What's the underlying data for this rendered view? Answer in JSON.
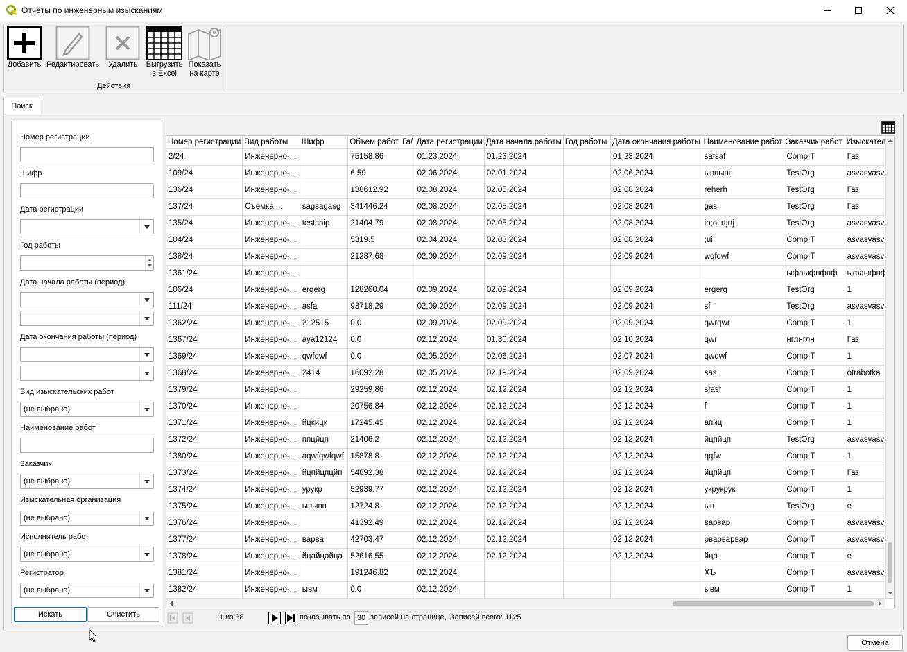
{
  "window": {
    "title": "Отчёты по инженерным изысканиям",
    "app_icon": "qgis-icon"
  },
  "toolbar": {
    "add_label": "Добавить",
    "edit_label": "Редактировать",
    "delete_label": "Удалить",
    "export_label_1": "Выгрузить",
    "export_label_2": "в Excel",
    "map_label_1": "Показать",
    "map_label_2": "на карте",
    "group_label": "Действия"
  },
  "tab": {
    "label": "Поиск"
  },
  "search": {
    "reg_number_label": "Номер регистрации",
    "cipher_label": "Шифр",
    "reg_date_label": "Дата регистрации",
    "work_year_label": "Год работы",
    "start_period_label": "Дата начала работы (период)",
    "end_period_label": "Дата окончания работы (период)",
    "survey_type_label": "Вид изыскательских работ",
    "survey_type_value": "(не выбрано)",
    "work_name_label": "Наименование работ",
    "customer_label": "Заказчик",
    "customer_value": "(не выбрано)",
    "survey_org_label": "Изыскательная организация",
    "survey_org_value": "(не выбрано)",
    "executor_label": "Исполнитель работ",
    "executor_value": "(не выбрано)",
    "registrar_label": "Регистратор",
    "registrar_value": "(не выбрано)",
    "search_button": "Искать",
    "clear_button": "Очистить"
  },
  "table": {
    "columns": [
      "Номер регистрации",
      "Вид работы",
      "Шифр",
      "Объем работ, Га/",
      "Дата регистрации",
      "Дата начала работы",
      "Год работы",
      "Дата окончания работы",
      "Наименование работ",
      "Заказчик работ",
      "Изыскатель"
    ],
    "rows": [
      [
        "2/24",
        "Инженерно-...",
        "",
        "75158.86",
        "01.23.2024",
        "01.23.2024",
        "",
        "01.23.2024",
        "safsaf",
        "CompIT",
        "Газ"
      ],
      [
        "109/24",
        "Инженерно-...",
        "",
        "6.59",
        "02.06.2024",
        "02.01.2024",
        "",
        "02.06.2024",
        "ывпывп",
        "TestOrg",
        "asvasvasv"
      ],
      [
        "136/24",
        "Инженерно-...",
        "",
        "138612.92",
        "02.08.2024",
        "02.05.2024",
        "",
        "02.08.2024",
        "reherh",
        "TestOrg",
        "Газ"
      ],
      [
        "137/24",
        "Съемка ...",
        "sagsagasg",
        "341446.24",
        "02.08.2024",
        "02.05.2024",
        "",
        "02.08.2024",
        "gas",
        "TestOrg",
        "Газ"
      ],
      [
        "135/24",
        "Инженерно-...",
        "testship",
        "21404.79",
        "02.08.2024",
        "02.05.2024",
        "",
        "02.08.2024",
        "io;oi;rtjrtj",
        "TestOrg",
        "asvasvasv"
      ],
      [
        "104/24",
        "Инженерно-...",
        "",
        "5319.5",
        "02.04.2024",
        "02.03.2024",
        "",
        "02.08.2024",
        ";ui",
        "CompIT",
        "asvasvasv"
      ],
      [
        "138/24",
        "Инженерно-...",
        "",
        "21287.68",
        "02.09.2024",
        "02.09.2024",
        "",
        "02.09.2024",
        "wqfqwf",
        "CompIT",
        "asvasvasv"
      ],
      [
        "1361/24",
        "Инженерно-...",
        "",
        "",
        "",
        "",
        "",
        "",
        "",
        "ыфаыфпфпф",
        "ыфаыфпф"
      ],
      [
        "106/24",
        "Инженерно-...",
        "ergerg",
        "128260.04",
        "02.09.2024",
        "02.09.2024",
        "",
        "02.09.2024",
        "ergerg",
        "TestOrg",
        "1"
      ],
      [
        "111/24",
        "Инженерно-...",
        "asfa",
        "93718.29",
        "02.09.2024",
        "02.09.2024",
        "",
        "02.09.2024",
        "sf",
        "TestOrg",
        "asvasvasv"
      ],
      [
        "1362/24",
        "Инженерно-...",
        "212515",
        "0.0",
        "02.09.2024",
        "02.09.2024",
        "",
        "02.09.2024",
        "qwrqwr",
        "CompIT",
        "1"
      ],
      [
        "1367/24",
        "Инженерно-...",
        "aya12124",
        "0.0",
        "02.12.2024",
        "01.30.2024",
        "",
        "02.10.2024",
        "qwr",
        "нглнглн",
        "Газ"
      ],
      [
        "1369/24",
        "Инженерно-...",
        "qwfqwf",
        "0.0",
        "02.05.2024",
        "02.06.2024",
        "",
        "02.07.2024",
        "qwqwf",
        "CompIT",
        "1"
      ],
      [
        "1368/24",
        "Инженерно-...",
        "2414",
        "16092.28",
        "02.05.2024",
        "02.19.2024",
        "",
        "02.09.2024",
        "sas",
        "CompIT",
        "otrabotka"
      ],
      [
        "1379/24",
        "Инженерно-...",
        "",
        "29259.86",
        "02.12.2024",
        "02.12.2024",
        "",
        "02.12.2024",
        "sfasf",
        "CompIT",
        "1"
      ],
      [
        "1370/24",
        "Инженерно-...",
        "",
        "20756.84",
        "02.12.2024",
        "02.12.2024",
        "",
        "02.12.2024",
        "f",
        "CompIT",
        "1"
      ],
      [
        "1371/24",
        "Инженерно-...",
        "йцкйцк",
        "17245.45",
        "02.12.2024",
        "02.12.2024",
        "",
        "02.12.2024",
        "апйц",
        "CompIT",
        "1"
      ],
      [
        "1372/24",
        "Инженерно-...",
        "ппцйцп",
        "21406.2",
        "02.12.2024",
        "02.12.2024",
        "",
        "02.12.2024",
        "йцпйцп",
        "TestOrg",
        "asvasvasv"
      ],
      [
        "1380/24",
        "Инженерно-...",
        "aqwfqwfqwf",
        "15878.8",
        "02.12.2024",
        "02.12.2024",
        "",
        "02.12.2024",
        "qqfw",
        "CompIT",
        "1"
      ],
      [
        "1373/24",
        "Инженерно-...",
        "йцпйцпцйп",
        "54892.38",
        "02.12.2024",
        "02.12.2024",
        "",
        "02.12.2024",
        "йцпйцп",
        "CompIT",
        "Газ"
      ],
      [
        "1374/24",
        "Инженерно-...",
        "урукр",
        "52939.77",
        "02.12.2024",
        "02.12.2024",
        "",
        "02.12.2024",
        "укрукрук",
        "CompIT",
        "1"
      ],
      [
        "1375/24",
        "Инженерно-...",
        "ыпывп",
        "12724.8",
        "02.12.2024",
        "02.12.2024",
        "",
        "02.12.2024",
        "ып",
        "TestOrg",
        "e"
      ],
      [
        "1376/24",
        "Инженерно-...",
        "",
        "41392.49",
        "02.12.2024",
        "02.12.2024",
        "",
        "02.12.2024",
        "варвар",
        "CompIT",
        "asvasvasv"
      ],
      [
        "1377/24",
        "Инженерно-...",
        "варва",
        "42703.47",
        "02.12.2024",
        "02.12.2024",
        "",
        "02.12.2024",
        "рварварвар",
        "CompIT",
        "asvasvasv"
      ],
      [
        "1378/24",
        "Инженерно-...",
        "йцайцайца",
        "52616.55",
        "02.12.2024",
        "02.12.2024",
        "",
        "02.12.2024",
        "йца",
        "CompIT",
        "e"
      ],
      [
        "1381/24",
        "Инженерно-...",
        "",
        "191246.82",
        "02.12.2024",
        "",
        "",
        "",
        "ХЪ",
        "CompIT",
        "asvasvasv"
      ],
      [
        "1382/24",
        "Инженерно-...",
        "ывм",
        "0.0",
        "02.12.2024",
        "",
        "",
        "",
        "ывм",
        "CompIT",
        "1"
      ]
    ]
  },
  "pager": {
    "page_info": "1 из 38",
    "show_by": "показывать по",
    "per_page": "30",
    "per_page_suffix": "записей на странице,",
    "total": "Записей всего: 1125"
  },
  "footer": {
    "cancel_button": "Отмена"
  }
}
